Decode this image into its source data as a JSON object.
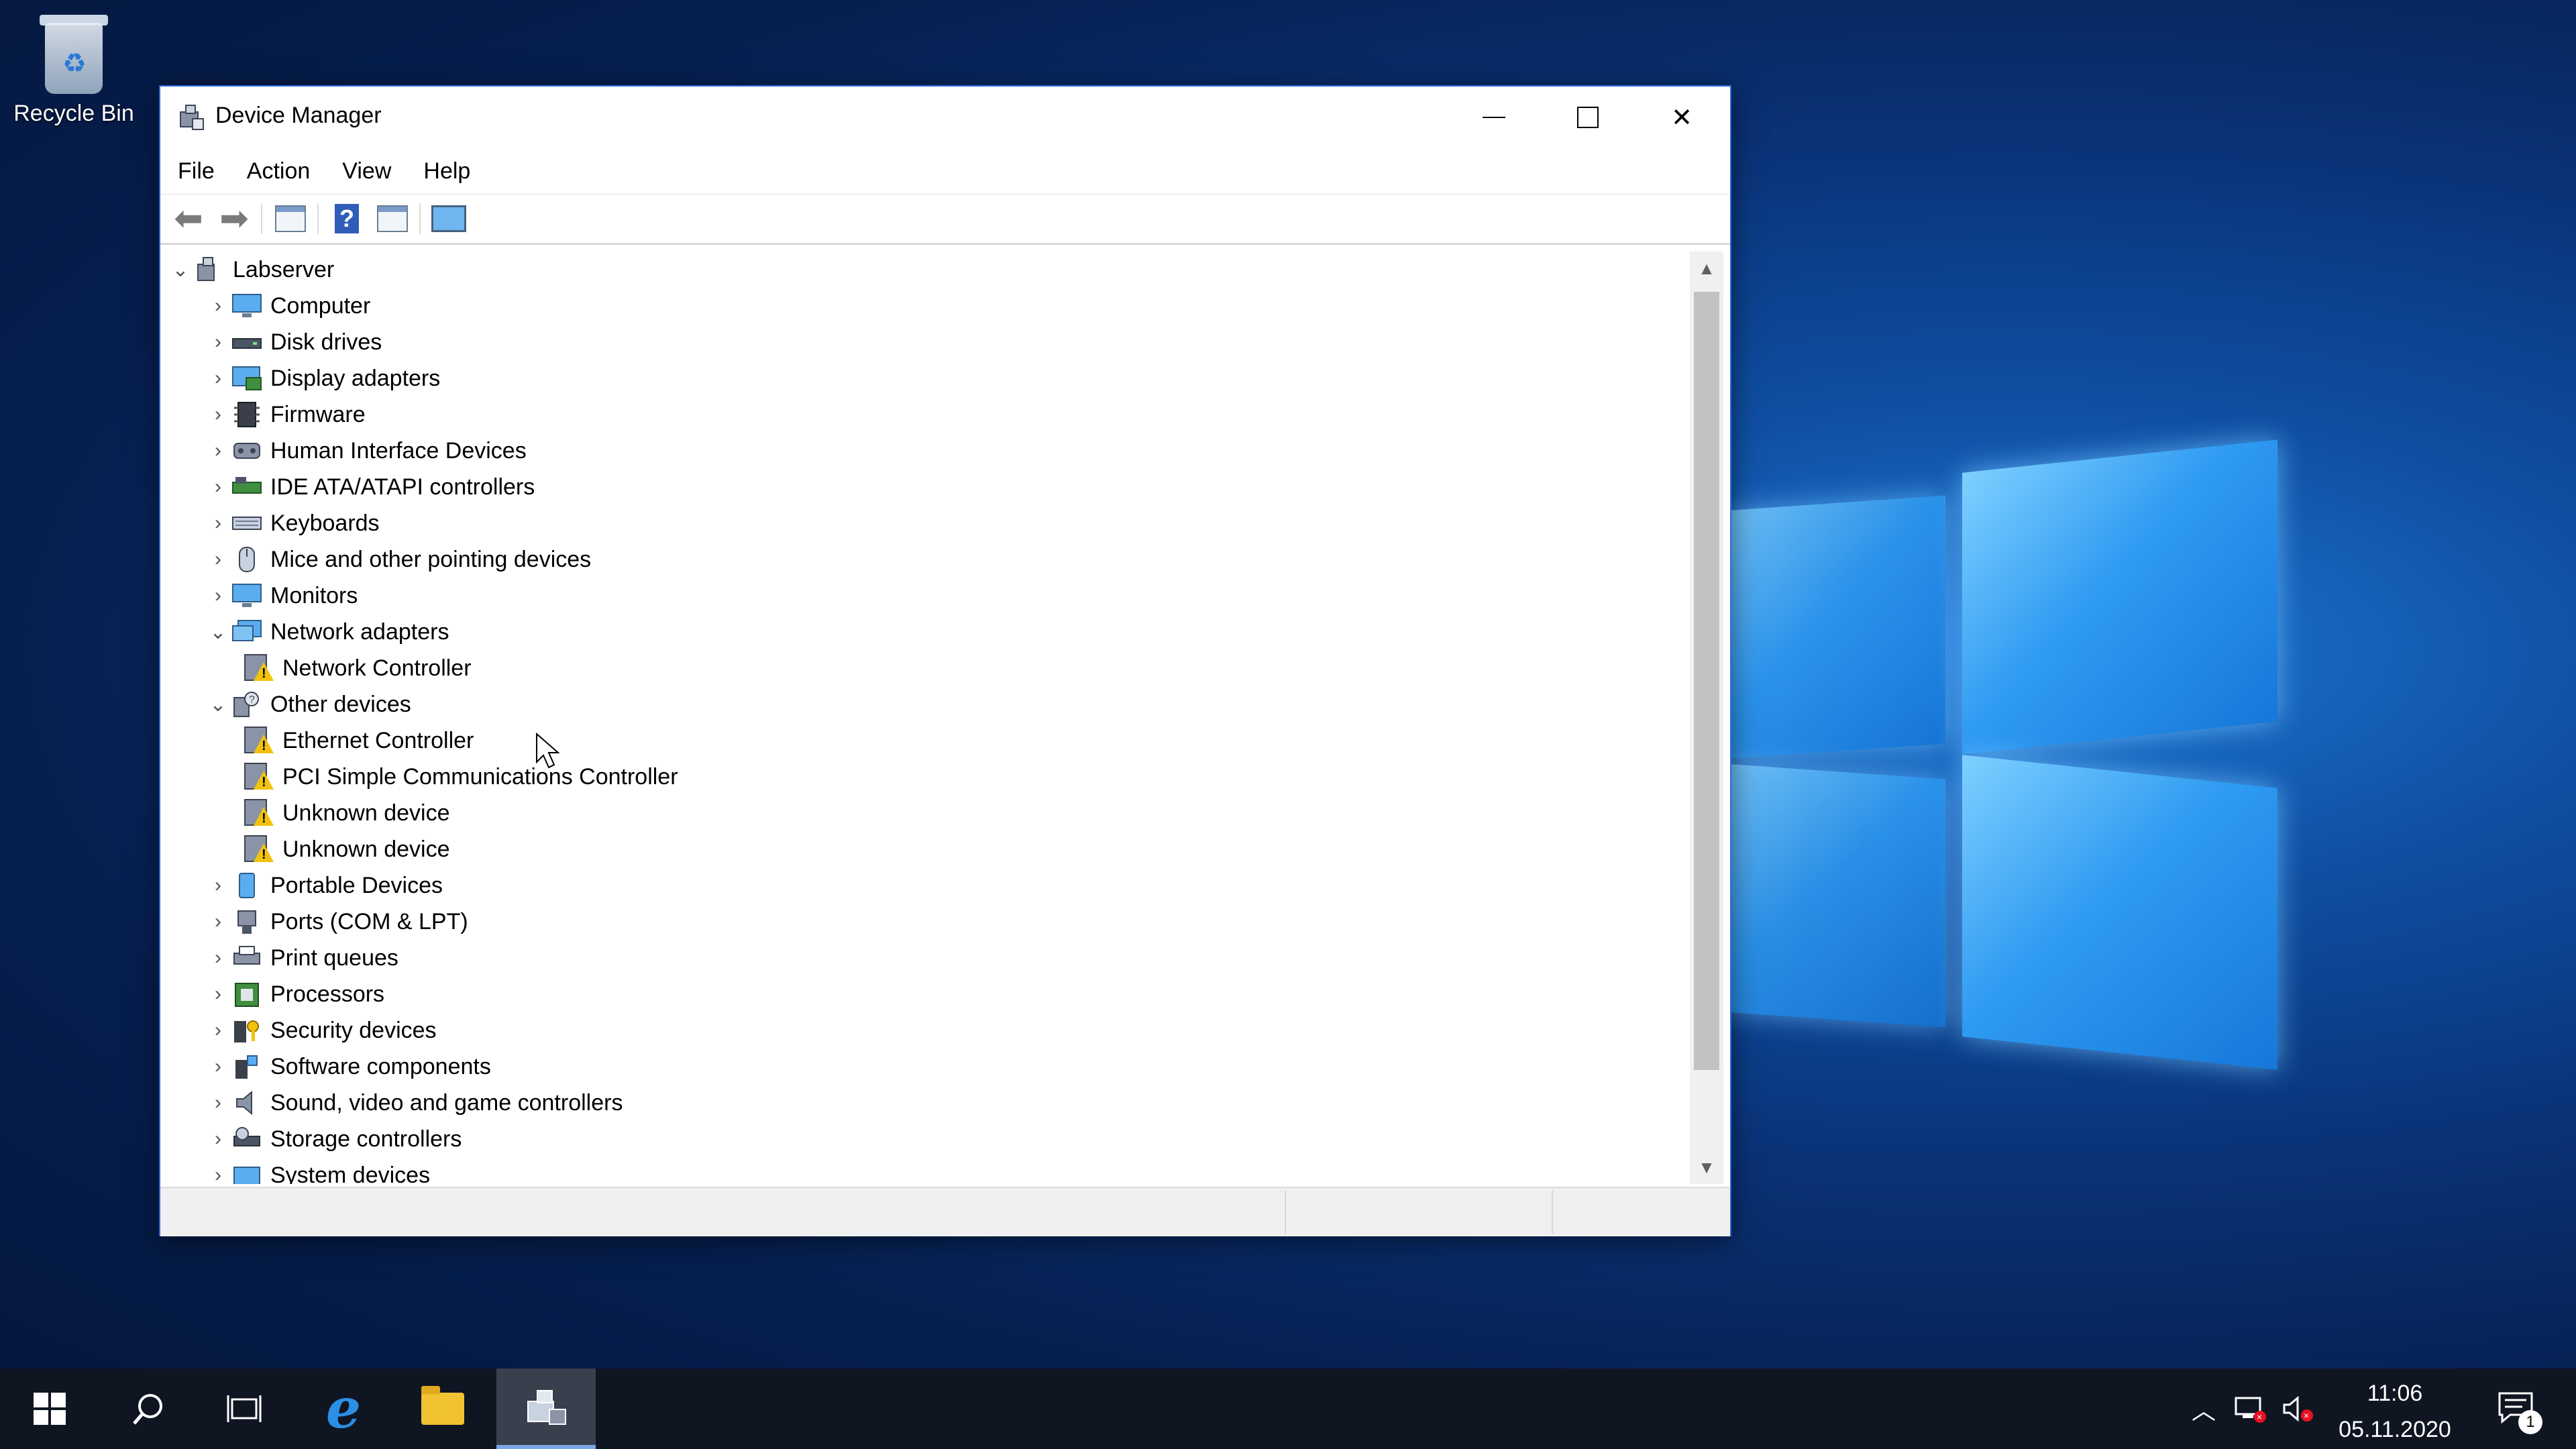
{
  "desktop": {
    "recycle_bin_label": "Recycle Bin"
  },
  "window": {
    "title": "Device Manager",
    "controls": {
      "minimize": "─",
      "maximize": "☐",
      "close": "✕"
    }
  },
  "menu": [
    "File",
    "Action",
    "View",
    "Help"
  ],
  "tree": {
    "root": "Labserver",
    "items": [
      {
        "label": "Computer",
        "expanded": false
      },
      {
        "label": "Disk drives",
        "expanded": false
      },
      {
        "label": "Display adapters",
        "expanded": false
      },
      {
        "label": "Firmware",
        "expanded": false
      },
      {
        "label": "Human Interface Devices",
        "expanded": false
      },
      {
        "label": "IDE ATA/ATAPI controllers",
        "expanded": false
      },
      {
        "label": "Keyboards",
        "expanded": false
      },
      {
        "label": "Mice and other pointing devices",
        "expanded": false
      },
      {
        "label": "Monitors",
        "expanded": false
      },
      {
        "label": "Network adapters",
        "expanded": true,
        "children": [
          "Network Controller"
        ]
      },
      {
        "label": "Other devices",
        "expanded": true,
        "children": [
          "Ethernet Controller",
          "PCI Simple Communications Controller",
          "Unknown device",
          "Unknown device"
        ]
      },
      {
        "label": "Portable Devices",
        "expanded": false
      },
      {
        "label": "Ports (COM & LPT)",
        "expanded": false
      },
      {
        "label": "Print queues",
        "expanded": false
      },
      {
        "label": "Processors",
        "expanded": false
      },
      {
        "label": "Security devices",
        "expanded": false
      },
      {
        "label": "Software components",
        "expanded": false
      },
      {
        "label": "Sound, video and game controllers",
        "expanded": false
      },
      {
        "label": "Storage controllers",
        "expanded": false
      },
      {
        "label": "System devices",
        "expanded": false
      }
    ]
  },
  "taskbar": {
    "clock_time": "11:06",
    "clock_date": "05.11.2020",
    "notification_count": "1"
  },
  "colors": {
    "accent": "#2b6cd4",
    "warning": "#f2c20c",
    "taskbar": "#101522"
  }
}
